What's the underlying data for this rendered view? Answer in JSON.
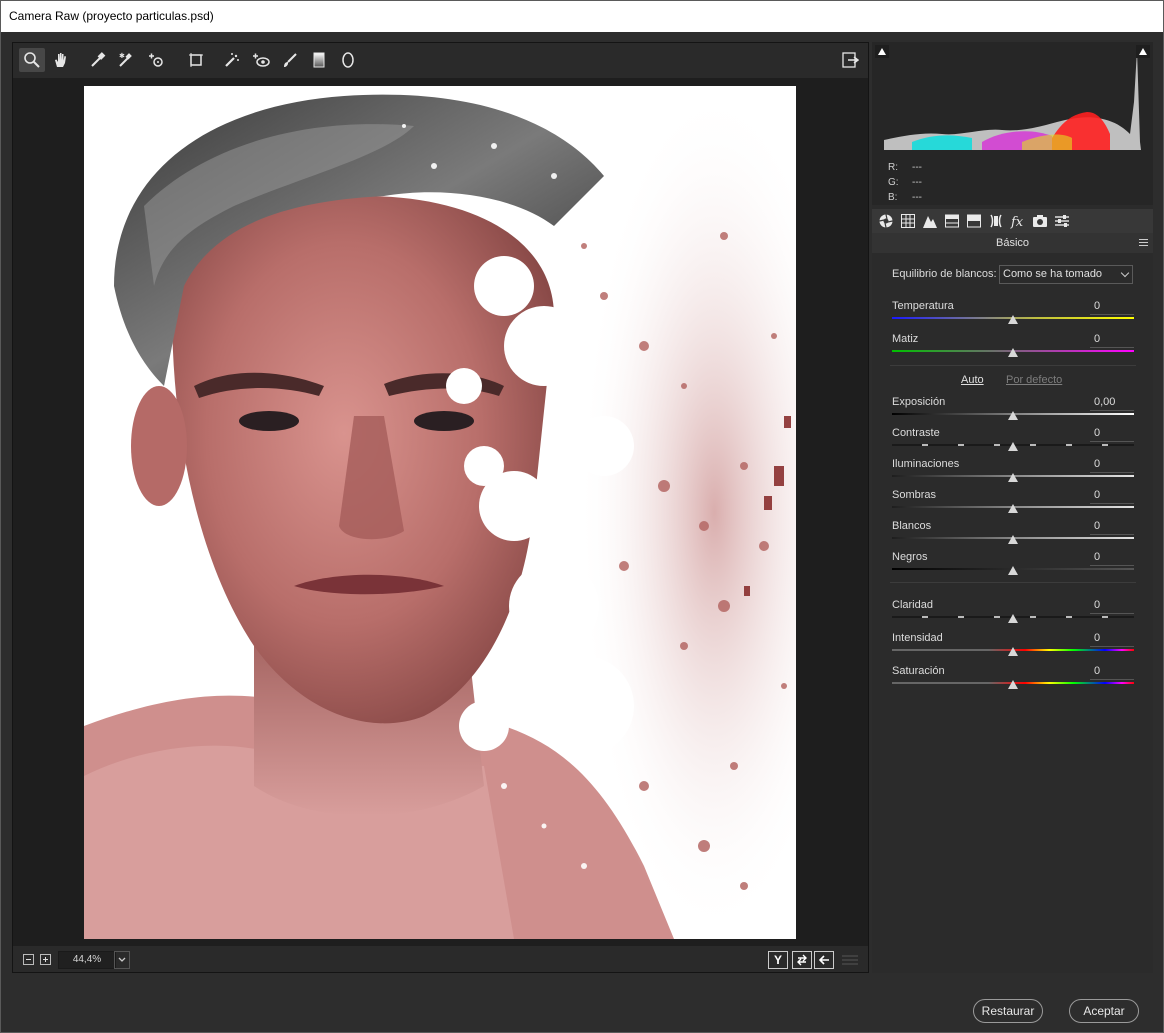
{
  "window": {
    "title": "Camera Raw (proyecto particulas.psd)"
  },
  "toolbar": {
    "tools": [
      {
        "name": "zoom-tool",
        "icon": "magnifier-icon",
        "active": true
      },
      {
        "name": "hand-tool",
        "icon": "hand-icon"
      },
      {
        "name": "white-balance-tool",
        "icon": "eyedropper-icon"
      },
      {
        "name": "color-sampler-tool",
        "icon": "color-sampler-icon"
      },
      {
        "name": "targeted-adjustment-tool",
        "icon": "target-adjust-icon"
      },
      {
        "name": "transform-tool",
        "icon": "transform-icon"
      },
      {
        "name": "spot-removal-tool",
        "icon": "spot-removal-icon"
      },
      {
        "name": "red-eye-tool",
        "icon": "red-eye-icon"
      },
      {
        "name": "adjustment-brush-tool",
        "icon": "brush-icon"
      },
      {
        "name": "graduated-filter-tool",
        "icon": "gradient-icon"
      },
      {
        "name": "radial-filter-tool",
        "icon": "radial-icon"
      }
    ]
  },
  "bottombar": {
    "zoom_value": "44,4%",
    "view_y_label": "Y"
  },
  "histogram": {
    "r_label": "R:",
    "g_label": "G:",
    "b_label": "B:",
    "r": "---",
    "g": "---",
    "b": "---"
  },
  "panel": {
    "title": "Básico",
    "white_balance": {
      "label": "Equilibrio de blancos:",
      "value": "Como se ha tomado"
    },
    "auto_label": "Auto",
    "default_label": "Por defecto",
    "sliders": [
      {
        "label": "Temperatura",
        "value": "0",
        "track": "temperature"
      },
      {
        "label": "Matiz",
        "value": "0",
        "track": "tint"
      },
      {
        "label": "Exposición",
        "value": "0,00",
        "track": "exposure"
      },
      {
        "label": "Contraste",
        "value": "0",
        "track": "contrast"
      },
      {
        "label": "Iluminaciones",
        "value": "0",
        "track": "gray"
      },
      {
        "label": "Sombras",
        "value": "0",
        "track": "gray"
      },
      {
        "label": "Blancos",
        "value": "0",
        "track": "gray"
      },
      {
        "label": "Negros",
        "value": "0",
        "track": "black"
      },
      {
        "label": "Claridad",
        "value": "0",
        "track": "contrast"
      },
      {
        "label": "Intensidad",
        "value": "0",
        "track": "rainbow"
      },
      {
        "label": "Saturación",
        "value": "0",
        "track": "rainbow"
      }
    ]
  },
  "footer": {
    "restore_label": "Restaurar",
    "accept_label": "Aceptar"
  },
  "colors": {
    "background": "#2d2d2d",
    "panel": "#2b2b2b",
    "canvas": "#1e1e1e",
    "accent": "#ffffff"
  }
}
